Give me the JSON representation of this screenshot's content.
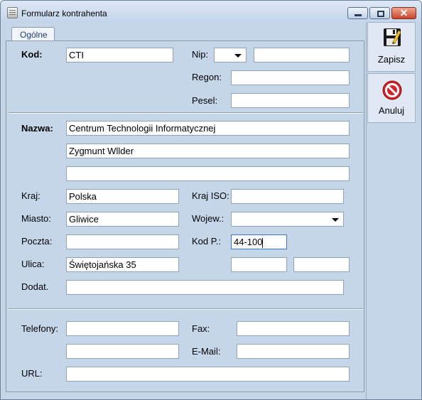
{
  "window": {
    "title": "Formularz kontrahenta"
  },
  "tabs": [
    {
      "label": "Ogólne"
    }
  ],
  "toolbar": {
    "save_label": "Zapisz",
    "cancel_label": "Anuluj"
  },
  "form": {
    "kod": {
      "label": "Kod:",
      "value": "CTI"
    },
    "nip": {
      "label": "Nip:",
      "prefix": "",
      "value": ""
    },
    "regon": {
      "label": "Regon:",
      "value": ""
    },
    "pesel": {
      "label": "Pesel:",
      "value": ""
    },
    "nazwa": {
      "label": "Nazwa:",
      "line1": "Centrum Technologii Informatycznej",
      "line2": "Zygmunt Wllder",
      "line3": ""
    },
    "kraj": {
      "label": "Kraj:",
      "value": "Polska"
    },
    "kraj_iso": {
      "label": "Kraj ISO:",
      "value": ""
    },
    "miasto": {
      "label": "Miasto:",
      "value": "Gliwice"
    },
    "wojew": {
      "label": "Wojew.:",
      "value": ""
    },
    "poczta": {
      "label": "Poczta:",
      "value": ""
    },
    "kod_p": {
      "label": "Kod P.:",
      "value": "44-100"
    },
    "ulica": {
      "label": "Ulica:",
      "value": "Świętojańska 35",
      "nr_domu": "",
      "nr_lokalu": ""
    },
    "dodat": {
      "label": "Dodat.",
      "value": ""
    },
    "telefony": {
      "label": "Telefony:",
      "value1": "",
      "value2": ""
    },
    "fax": {
      "label": "Fax:",
      "value": ""
    },
    "email": {
      "label": "E-Mail:",
      "value": ""
    },
    "url": {
      "label": "URL:",
      "value": ""
    }
  },
  "colors": {
    "window_bg": "#c5d5e8",
    "close_button": "#c8452a",
    "cancel_icon": "#d0242a",
    "focus_border": "#3a78c6"
  }
}
